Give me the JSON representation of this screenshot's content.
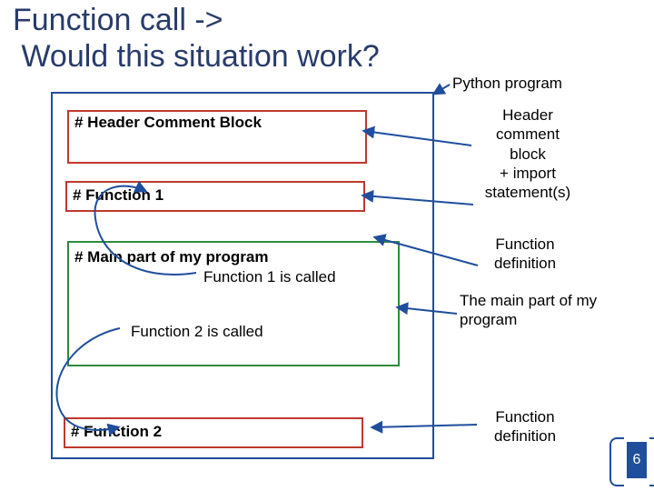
{
  "title_line1": "Function call ->",
  "title_line2": "Would this situation work?",
  "program_label": "Python program",
  "blocks": {
    "header_comment": "# Header Comment Block",
    "func1": "# Function 1",
    "main_heading": "# Main part of my program",
    "call1": "Function 1 is called",
    "call2": "Function 2 is called",
    "func2": "# Function 2"
  },
  "rhs": {
    "header": "Header\ncomment\nblock\n+ import\nstatement(s)",
    "funcdef1": "Function\ndefinition",
    "mainpart": "The main part of my\nprogram",
    "funcdef2": "Function\ndefinition"
  },
  "page_number": "6"
}
